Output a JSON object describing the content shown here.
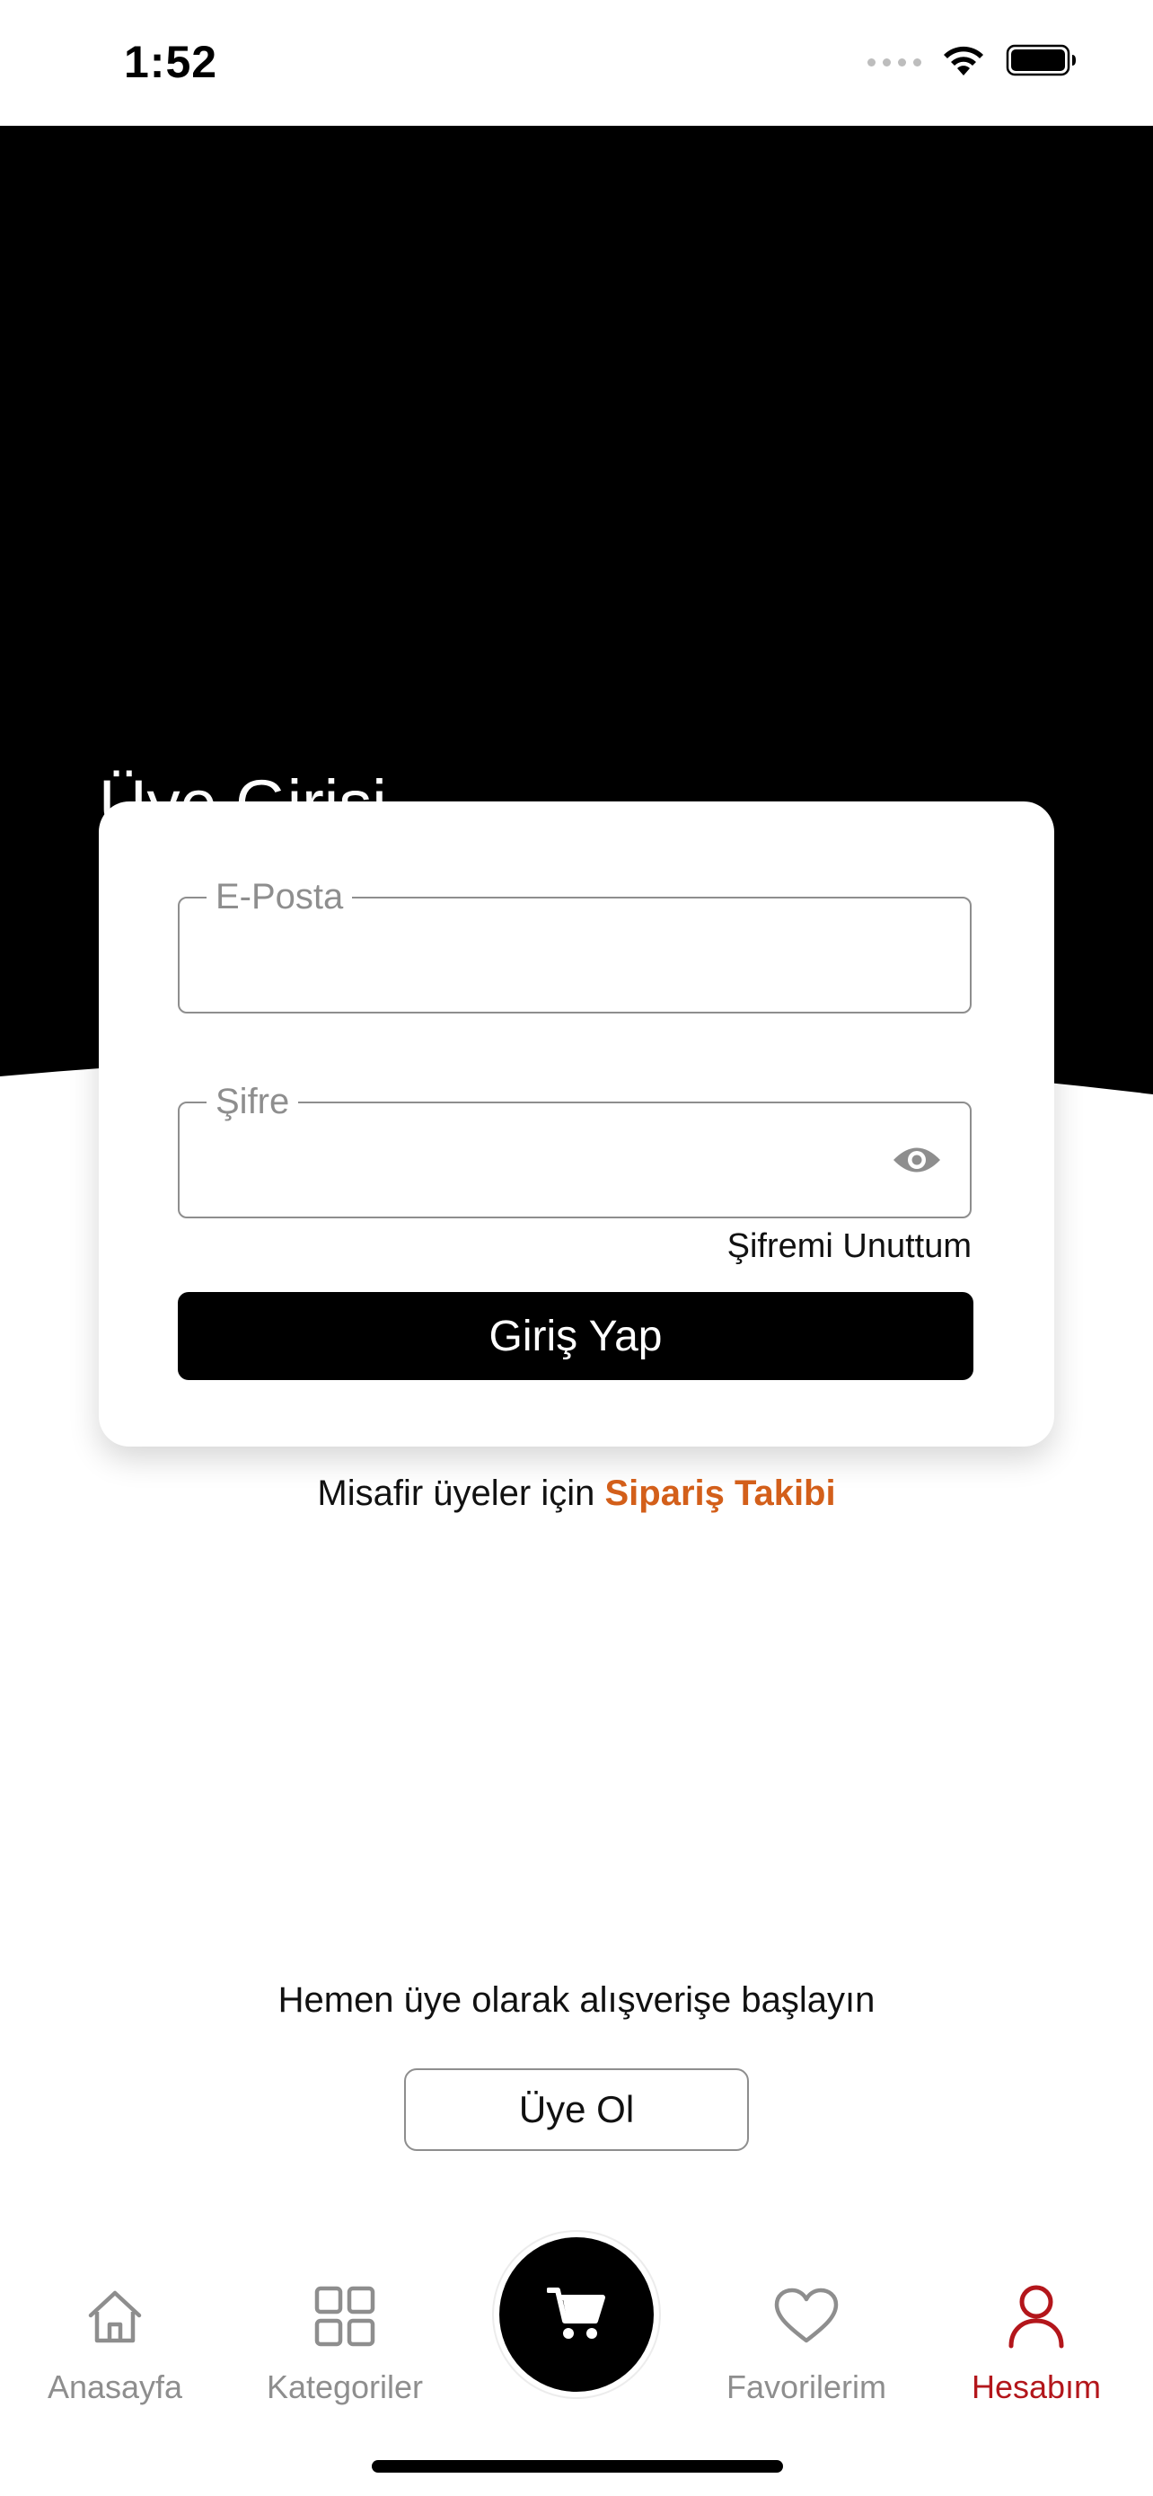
{
  "status_bar": {
    "time": "1:52"
  },
  "login": {
    "title": "Üye Girişi",
    "email_label": "E-Posta",
    "email_value": "",
    "password_label": "Şifre",
    "password_value": "",
    "forgot_password": "Şifremi Unuttum",
    "login_button": "Giriş Yap"
  },
  "guest": {
    "prefix": "Misafir üyeler için ",
    "link": "Sipariş Takibi"
  },
  "register": {
    "prompt": "Hemen üye olarak alışverişe başlayın",
    "button": "Üye Ol"
  },
  "tab_bar": {
    "home": "Anasayfa",
    "categories": "Kategoriler",
    "favorites": "Favorilerim",
    "account": "Hesabım",
    "active": "account"
  },
  "colors": {
    "accent_orange": "#d35f1a",
    "active_tab": "#b3161b",
    "hero_background": "#000000",
    "inactive_tab": "#8e8e8e"
  },
  "icons": {
    "home": "home-icon",
    "categories": "grid-icon",
    "cart": "cart-icon",
    "favorites": "heart-icon",
    "account": "user-icon",
    "password_visibility": "eye-icon",
    "wifi": "wifi-icon",
    "battery": "battery-icon"
  }
}
